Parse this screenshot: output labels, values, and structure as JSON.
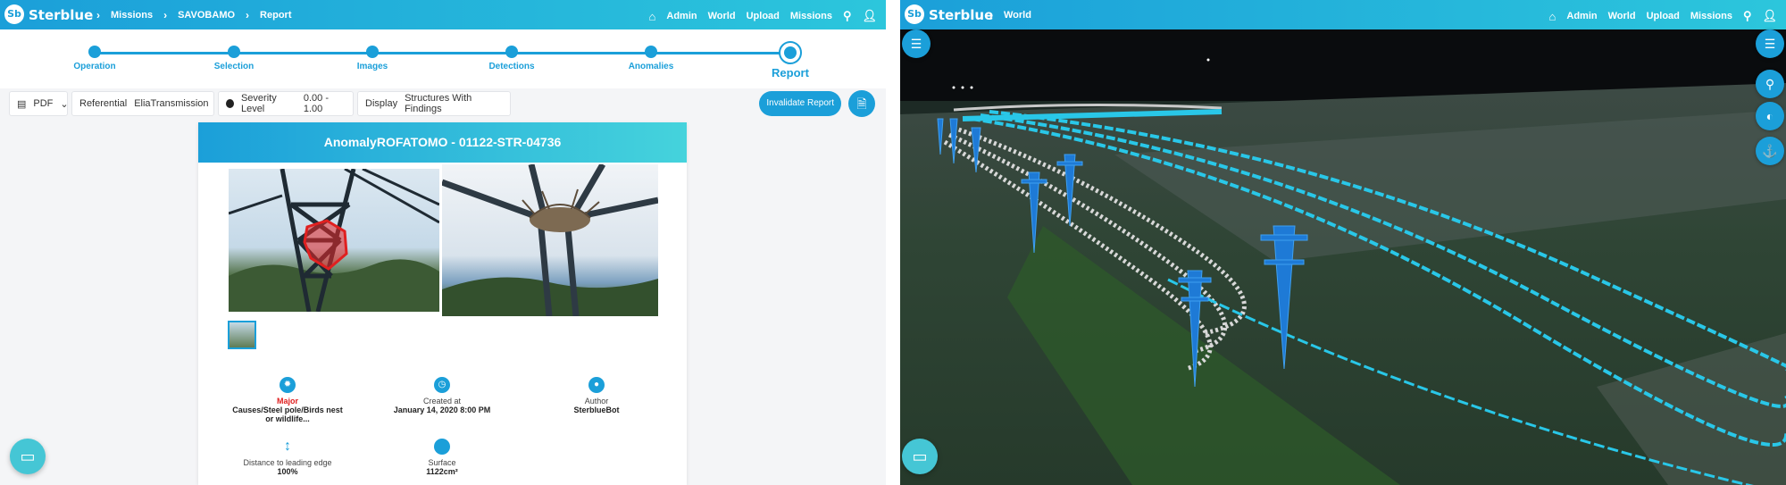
{
  "left": {
    "brand": "Sterblue",
    "logo_text": "Sb",
    "breadcrumbs": [
      "Missions",
      "SAVOBAMO",
      "Report"
    ],
    "nav": [
      "Admin",
      "World",
      "Upload",
      "Missions"
    ],
    "steps": [
      "Operation",
      "Selection",
      "Images",
      "Detections",
      "Anomalies",
      "Report"
    ],
    "active_step": "Report",
    "toolbar": {
      "format": "PDF",
      "referential_label": "Referential",
      "referential_value": "EliaTransmission",
      "severity_label": "Severity Level",
      "severity_value": "0.00 - 1.00",
      "display_label": "Display",
      "display_value": "Structures With Findings",
      "invalidate_label": "Invalidate Report"
    },
    "report": {
      "title": "AnomalyROFATOMO - 01122-STR-04736",
      "severity": "Major",
      "cause": "Causes/Steel pole/Birds nest or wildlife...",
      "created_label": "Created at",
      "created_value": "January 14, 2020 8:00 PM",
      "author_label": "Author",
      "author_value": "SterblueBot",
      "distance_label": "Distance to leading edge",
      "distance_value": "100%",
      "surface_label": "Surface",
      "surface_value": "1122cm²"
    }
  },
  "right": {
    "brand": "Sterblue",
    "logo_text": "Sb",
    "breadcrumbs": [
      "World"
    ],
    "nav": [
      "Admin",
      "World",
      "Upload",
      "Missions"
    ]
  },
  "colors": {
    "primary": "#1b9fd9",
    "accent": "#2cc6dc",
    "severity_major": "#e02020",
    "line_highlight": "#29c7e8",
    "tower": "#1e7ad6"
  },
  "icons": [
    "home-icon",
    "search-icon",
    "user-icon",
    "menu-icon",
    "compass-icon",
    "chat-icon",
    "document-icon",
    "clock-icon"
  ]
}
